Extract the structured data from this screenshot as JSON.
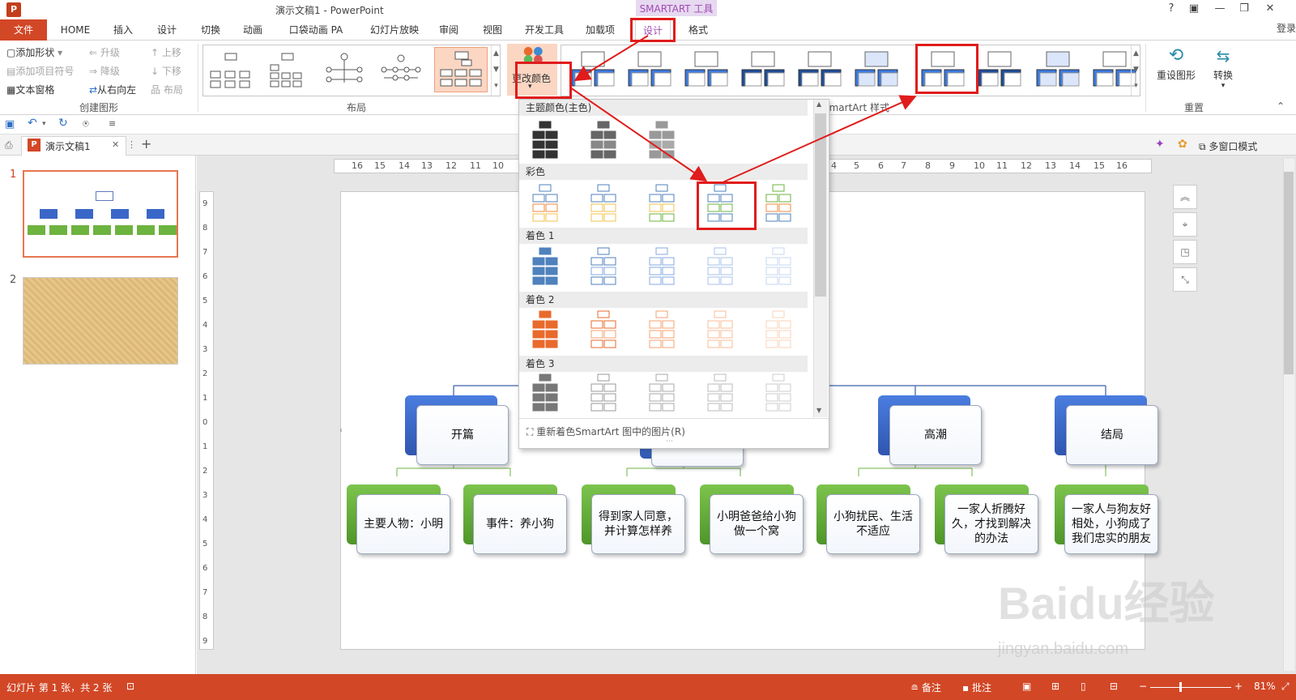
{
  "window": {
    "title": "演示文稿1 - PowerPoint",
    "context_tab_group": "SMARTART 工具",
    "signin": "登录",
    "controls": [
      "?",
      "▣",
      "—",
      "❐",
      "✕"
    ]
  },
  "tabs": [
    "文件",
    "HOME",
    "插入",
    "设计",
    "切换",
    "动画",
    "口袋动画 PA",
    "幻灯片放映",
    "审阅",
    "视图",
    "开发工具",
    "加载项",
    "设计",
    "格式"
  ],
  "ribbon": {
    "create_graphic": {
      "add_shape": "添加形状",
      "add_bullet": "添加项目符号",
      "text_pane": "文本窗格",
      "promote": "升级",
      "demote": "降级",
      "rtl": "从右向左",
      "move_up": "上移",
      "move_down": "下移",
      "layout": "布局",
      "label": "创建图形"
    },
    "layouts_label": "布局",
    "change_colors": "更改颜色",
    "styles_label": "SmartArt 样式",
    "reset_graphic": "重设图形",
    "convert": "转换",
    "reset_label": "重置"
  },
  "doc_tab": {
    "name": "演示文稿1",
    "close": "✕",
    "add": "+",
    "multiwindow": "多窗口模式"
  },
  "ruler": {
    "h_ticks": [
      "16",
      "15",
      "14",
      "13",
      "12",
      "11",
      "10",
      "4",
      "5",
      "6",
      "7",
      "8",
      "9",
      "10",
      "11",
      "12",
      "13",
      "14",
      "15",
      "16"
    ],
    "v_ticks": [
      "9",
      "8",
      "7",
      "6",
      "5",
      "4",
      "3",
      "2",
      "1",
      "0",
      "1",
      "2",
      "3",
      "4",
      "5",
      "6",
      "7",
      "8",
      "9"
    ]
  },
  "slides": [
    {
      "number": "1"
    },
    {
      "number": "2"
    }
  ],
  "color_dropdown": {
    "sections": [
      "主题颜色(主色)",
      "彩色",
      "着色 1",
      "着色 2",
      "着色 3"
    ],
    "recolor_pictures": "重新着色SmartArt 图中的图片(R)"
  },
  "diagram": {
    "level1": [
      "开篇",
      "",
      "高潮",
      "结局"
    ],
    "level2": [
      "主要人物：小明",
      "事件：养小狗",
      "得到家人同意，并计算怎样养",
      "小明爸爸给小狗做一个窝",
      "小狗扰民、生活不适应",
      "一家人折腾好久，才找到解决的办法",
      "一家人与狗友好相处，小狗成了我们忠实的朋友"
    ]
  },
  "statusbar": {
    "slide_info": "幻灯片 第 1 张，共 2 张",
    "notes": "备注",
    "comments": "批注",
    "zoom": "81%"
  },
  "watermark": {
    "brand": "Baidu经验",
    "url": "jingyan.baidu.com"
  },
  "colors": {
    "accent": "#d24726",
    "purple": "#a24bb3",
    "blue_node": "#3a67c7",
    "green_node": "#6db33f",
    "highlight": "#e01c1c"
  }
}
